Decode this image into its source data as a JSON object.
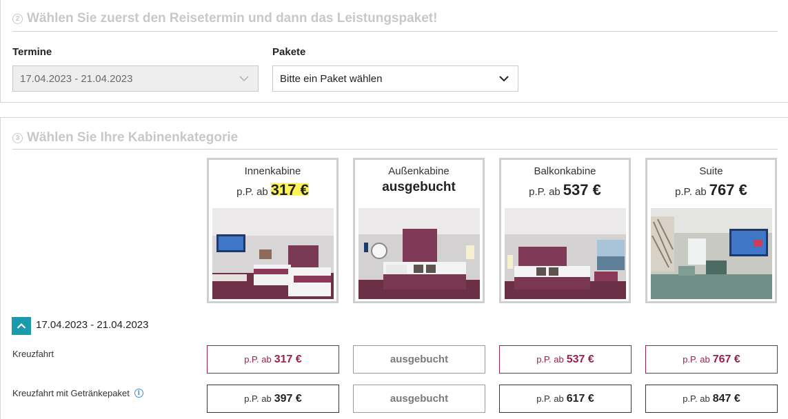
{
  "step2": {
    "number": "2",
    "title": "Wählen Sie zuerst den Reisetermin und dann das Leistungspaket!",
    "termine_label": "Termine",
    "termine_value": "17.04.2023 - 21.04.2023",
    "pakete_label": "Pakete",
    "pakete_value": "Bitte ein Paket wählen"
  },
  "step3": {
    "number": "3",
    "title": "Wählen Sie Ihre Kabinenkategorie"
  },
  "cabins": [
    {
      "name": "Innenkabine",
      "pp": "p.P. ab",
      "price": "317 €",
      "status": ""
    },
    {
      "name": "Außenkabine",
      "pp": "",
      "price": "",
      "status": "ausgebucht"
    },
    {
      "name": "Balkonkabine",
      "pp": "p.P. ab",
      "price": "537 €",
      "status": ""
    },
    {
      "name": "Suite",
      "pp": "p.P. ab",
      "price": "767 €",
      "status": ""
    }
  ],
  "date_row": "17.04.2023 - 21.04.2023",
  "rows": [
    {
      "label": "Kreuzfahrt",
      "cells": [
        {
          "pp": "p.P. ab",
          "price": "317 €",
          "status": ""
        },
        {
          "pp": "",
          "price": "",
          "status": "ausgebucht"
        },
        {
          "pp": "p.P. ab",
          "price": "537 €",
          "status": ""
        },
        {
          "pp": "p.P. ab",
          "price": "767 €",
          "status": ""
        }
      ]
    },
    {
      "label": "Kreuzfahrt mit Getränkepaket",
      "info_icon": "i",
      "cells": [
        {
          "pp": "p.P. ab",
          "price": "397 €",
          "status": ""
        },
        {
          "pp": "",
          "price": "",
          "status": "ausgebucht"
        },
        {
          "pp": "p.P. ab",
          "price": "617 €",
          "status": ""
        },
        {
          "pp": "p.P. ab",
          "price": "847 €",
          "status": ""
        }
      ]
    }
  ],
  "colors": {
    "accent_teal": "#1a9aab",
    "price_red": "#9c1e4c",
    "highlight_yellow": "#fff35a",
    "heading_grey": "#c8c8c8"
  },
  "icons": [
    "step-number-icon",
    "chevron-down-icon",
    "chevron-up-icon",
    "info-icon"
  ]
}
